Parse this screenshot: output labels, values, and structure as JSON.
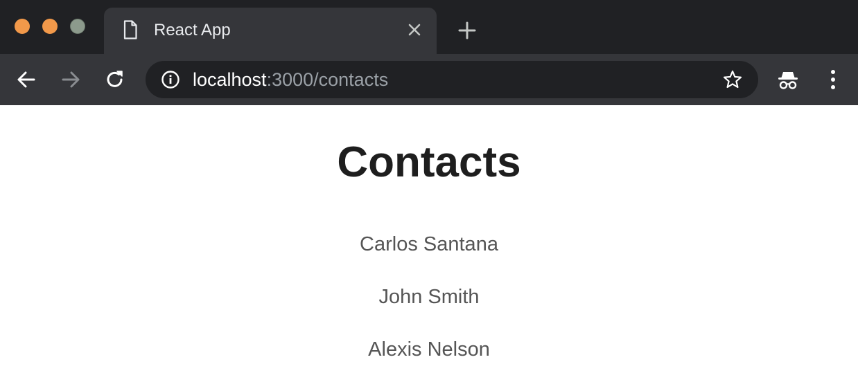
{
  "window": {
    "traffic_lights": {
      "close_color": "#f2994a",
      "minimize_color": "#f2994a",
      "zoom_color": "#8c9a8c"
    }
  },
  "tab": {
    "title": "React App",
    "icon": "document-icon",
    "close_icon": "close-icon"
  },
  "toolbar": {
    "back_icon": "arrow-left-icon",
    "forward_icon": "arrow-right-icon",
    "reload_icon": "reload-icon",
    "address": {
      "host": "localhost",
      "rest": ":3000/contacts",
      "info_icon": "info-icon"
    },
    "bookmark_icon": "star-icon",
    "incognito_icon": "incognito-icon",
    "menu_icon": "kebab-menu-icon"
  },
  "page": {
    "title": "Contacts",
    "contacts": [
      {
        "name": "Carlos Santana"
      },
      {
        "name": "John Smith"
      },
      {
        "name": "Alexis Nelson"
      }
    ]
  },
  "colors": {
    "tabstrip_bg": "#202124",
    "toolbar_bg": "#35363a",
    "text_muted": "#555555",
    "title": "#1e1e1e"
  }
}
